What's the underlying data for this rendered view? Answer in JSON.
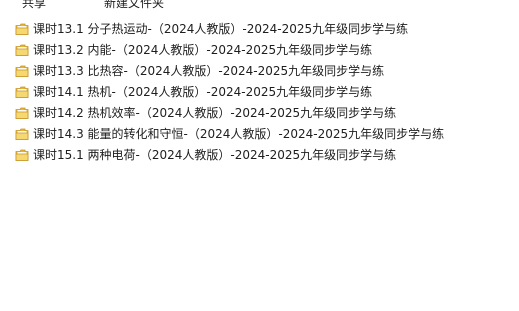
{
  "toolbar": {
    "items": [
      "共享",
      "新建文件夹"
    ]
  },
  "icons": {
    "folder": "folder-icon"
  },
  "colors": {
    "folder_body": "#e8b62c",
    "folder_light": "#f6d870",
    "folder_edge": "#c8952a",
    "text": "#1e1e1e"
  },
  "files": [
    {
      "name": "课时13.1  分子热运动-（2024人教版）-2024-2025九年级同步学与练"
    },
    {
      "name": "课时13.2  内能-（2024人教版）-2024-2025九年级同步学与练"
    },
    {
      "name": "课时13.3  比热容-（2024人教版）-2024-2025九年级同步学与练"
    },
    {
      "name": "课时14.1  热机-（2024人教版）-2024-2025九年级同步学与练"
    },
    {
      "name": "课时14.2  热机效率-（2024人教版）-2024-2025九年级同步学与练"
    },
    {
      "name": "课时14.3  能量的转化和守恒-（2024人教版）-2024-2025九年级同步学与练"
    },
    {
      "name": "课时15.1  两种电荷-（2024人教版）-2024-2025九年级同步学与练"
    }
  ]
}
